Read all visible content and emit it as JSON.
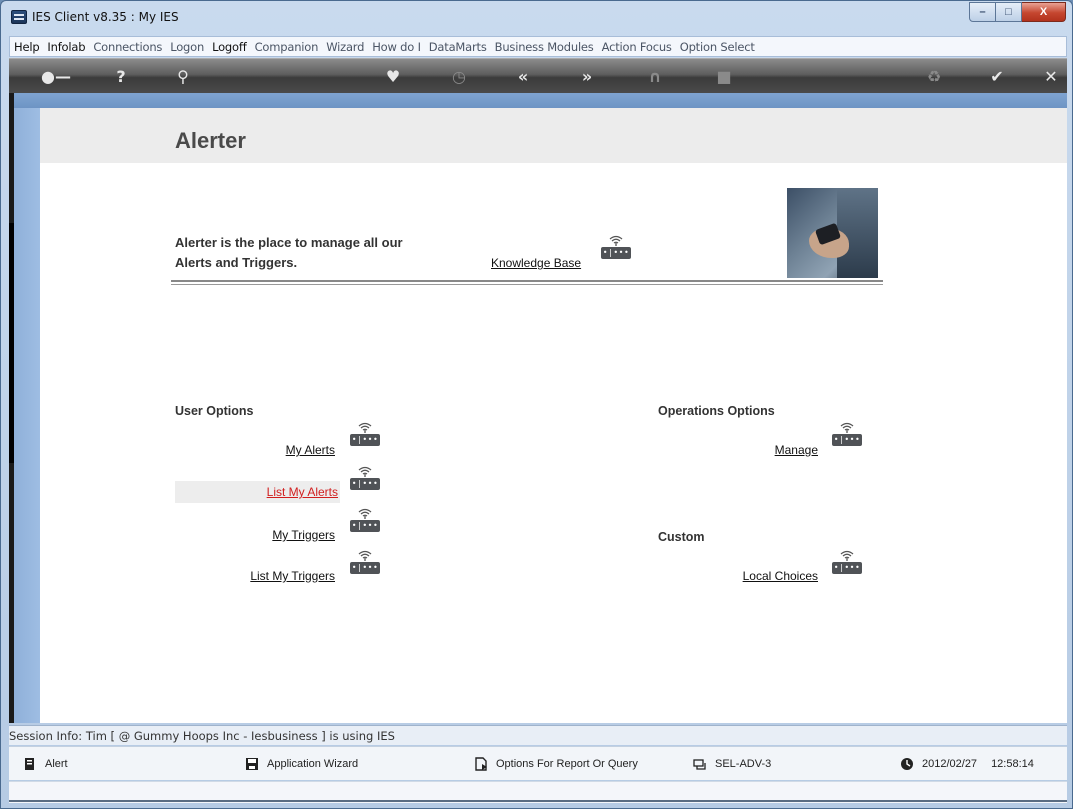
{
  "window": {
    "title": "IES Client v8.35 : My IES"
  },
  "menu": {
    "items": [
      "Help",
      "Infolab",
      "Connections",
      "Logon",
      "Logoff",
      "Companion",
      "Wizard",
      "How do I",
      "DataMarts",
      "Business Modules",
      "Action Focus",
      "Option Select"
    ]
  },
  "toolbar": {
    "icons": [
      "key-icon",
      "help-icon",
      "search-icon",
      "heart-icon",
      "clock-icon",
      "back-icon",
      "forward-icon",
      "tools-icon",
      "stop-icon",
      "recycle-icon",
      "check-icon",
      "close-icon"
    ]
  },
  "page": {
    "title": "Alerter",
    "intro_line1": "Alerter is the place to manage all our",
    "intro_line2": "Alerts and Triggers.",
    "knowledge_base": "Knowledge Base",
    "user_options": {
      "heading": "User Options",
      "items": [
        "My Alerts",
        "List My Alerts",
        "My Triggers",
        "List My Triggers"
      ]
    },
    "operations_options": {
      "heading": "Operations Options",
      "items": [
        "Manage"
      ]
    },
    "custom": {
      "heading": "Custom",
      "items": [
        "Local Choices"
      ]
    }
  },
  "session": {
    "info": "Session Info: Tim [ @ Gummy Hoops Inc  - Iesbusiness ] is using IES"
  },
  "status": {
    "alert": "Alert",
    "app_wizard": "Application Wizard",
    "options_report": "Options For Report Or Query",
    "server": "SEL-ADV-3",
    "date": "2012/02/27",
    "time": "12:58:14"
  },
  "colors": {
    "link_active": "#d11e1e",
    "toolbar": "#4a4a4a",
    "frame": "#6f97c7"
  }
}
